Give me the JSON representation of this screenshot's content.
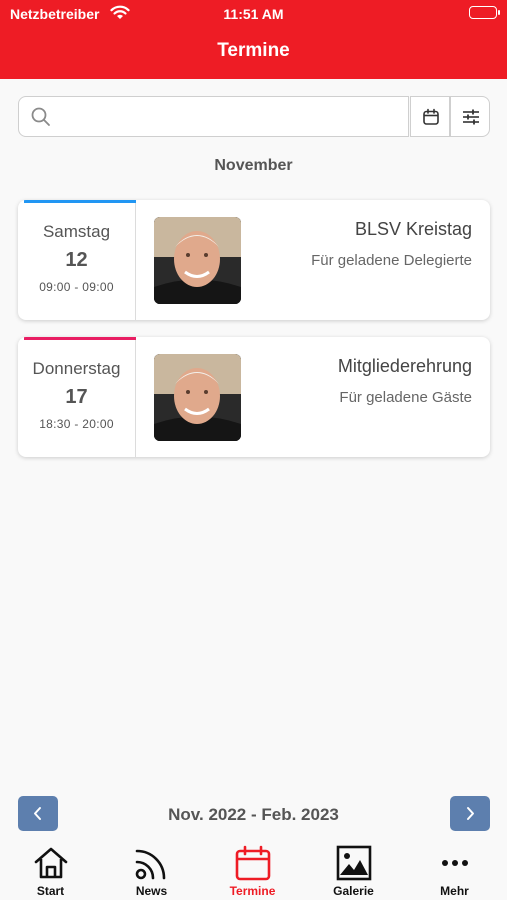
{
  "status_bar": {
    "carrier": "Netzbetreiber",
    "time": "11:51 AM"
  },
  "nav": {
    "title": "Termine"
  },
  "search": {
    "value": "",
    "placeholder": ""
  },
  "month_header": "November",
  "events": [
    {
      "weekday": "Samstag",
      "day": "12",
      "time": "09:00 - 09:00",
      "title": "BLSV Kreistag",
      "subtitle": "Für geladene Delegierte",
      "accent_color": "#2196f3"
    },
    {
      "weekday": "Donnerstag",
      "day": "17",
      "time": "18:30 - 20:00",
      "title": "Mitgliederehrung",
      "subtitle": "Für geladene Gäste",
      "accent_color": "#e91e63"
    }
  ],
  "pager": {
    "range": "Nov. 2022 - Feb. 2023"
  },
  "tabs": [
    {
      "label": "Start",
      "icon": "home-icon"
    },
    {
      "label": "News",
      "icon": "rss-icon"
    },
    {
      "label": "Termine",
      "icon": "calendar-icon",
      "active": true
    },
    {
      "label": "Galerie",
      "icon": "image-icon"
    },
    {
      "label": "Mehr",
      "icon": "more-icon"
    }
  ],
  "colors": {
    "brand": "#ee1c25",
    "pager_button": "#5d7fae"
  }
}
